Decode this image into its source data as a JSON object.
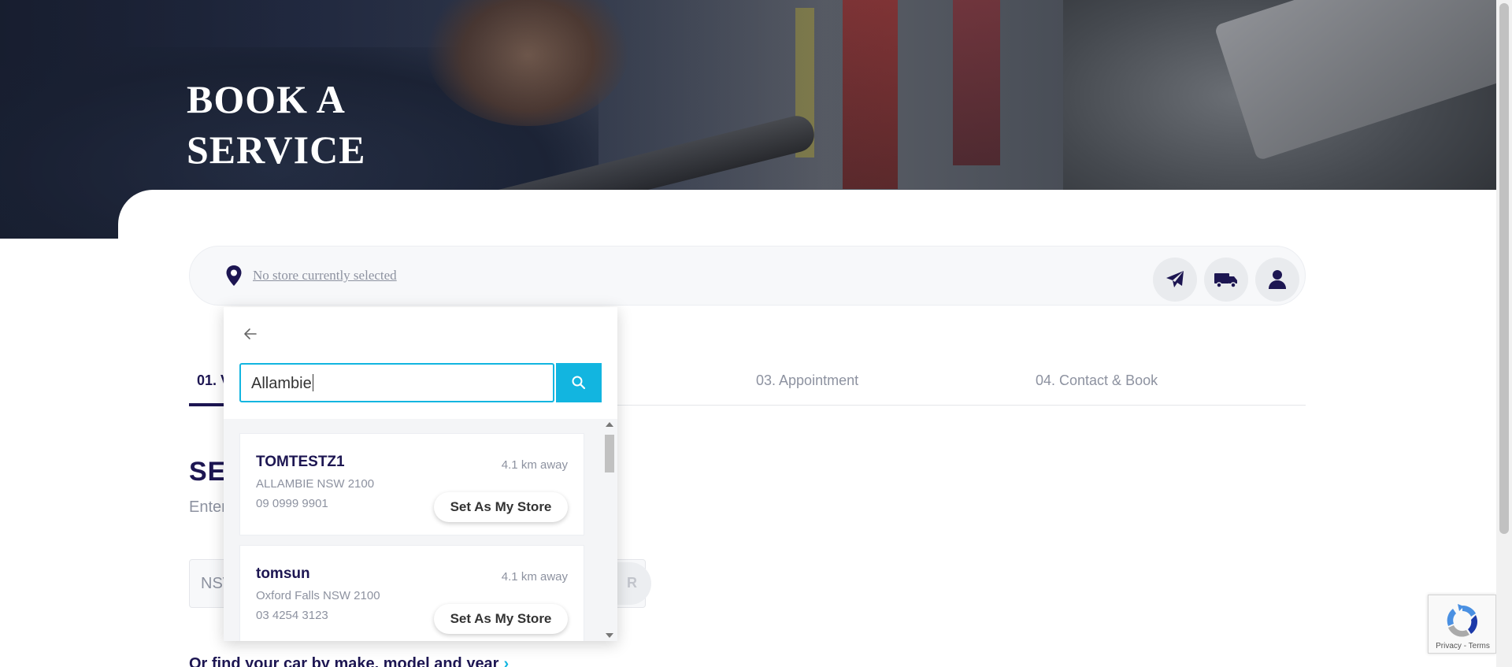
{
  "hero": {
    "title_line1": "BOOK A",
    "title_line2": "SERVICE"
  },
  "store_bar": {
    "status_text": "No store currently selected",
    "icons": [
      "location-pin-icon",
      "paper-plane-icon",
      "truck-icon",
      "user-icon"
    ]
  },
  "steps": [
    {
      "label": "01. V",
      "active": true
    },
    {
      "label": "03. Appointment",
      "active": false
    },
    {
      "label": "04. Contact & Book",
      "active": false
    }
  ],
  "section": {
    "title": "SE",
    "subtitle": "Enter",
    "plate_value": "NSV",
    "search_button_fragment": "R",
    "find_link": "Or find your car by make, model and year"
  },
  "store_search": {
    "query": "Allambie",
    "results": [
      {
        "name": "TOMTESTZ1",
        "distance": "4.1 km away",
        "address": "ALLAMBIE NSW 2100",
        "phone": "09 0999 9901",
        "action": "Set As My Store"
      },
      {
        "name": "tomsun",
        "distance": "4.1 km away",
        "address": "Oxford Falls NSW 2100",
        "phone": "03 4254 3123",
        "action": "Set As My Store"
      }
    ]
  },
  "recaptcha": {
    "privacy": "Privacy",
    "separator": " - ",
    "terms": "Terms"
  },
  "colors": {
    "accent": "#12b5e0",
    "navy": "#1d1652",
    "muted": "#8d92a0"
  }
}
